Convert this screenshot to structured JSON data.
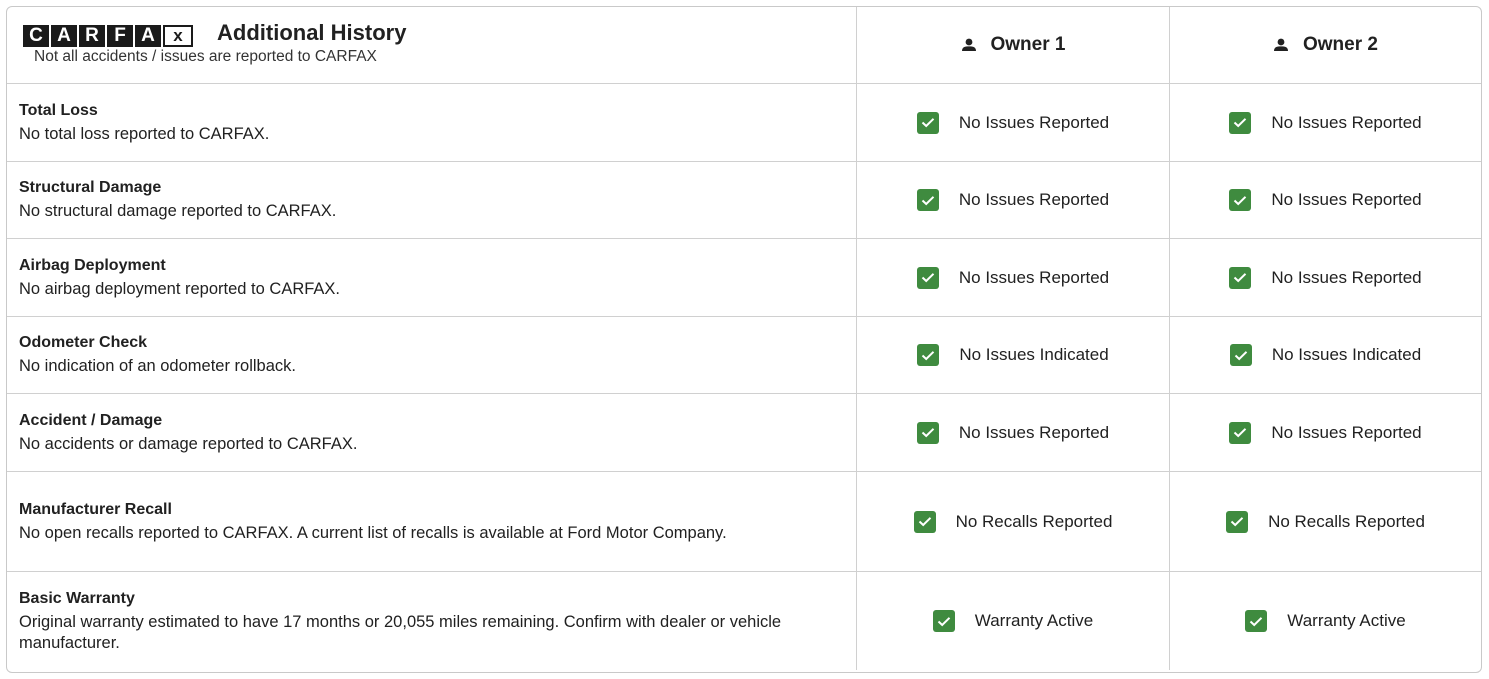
{
  "header": {
    "logo_letters": [
      "C",
      "A",
      "R",
      "F",
      "A",
      "x"
    ],
    "title": "Additional History",
    "subtitle": "Not all accidents / issues are reported to CARFAX",
    "owners": [
      "Owner 1",
      "Owner 2"
    ]
  },
  "rows": [
    {
      "title": "Total Loss",
      "desc": "No total loss reported to CARFAX.",
      "status": [
        "No Issues Reported",
        "No Issues Reported"
      ]
    },
    {
      "title": "Structural Damage",
      "desc": "No structural damage reported to CARFAX.",
      "status": [
        "No Issues Reported",
        "No Issues Reported"
      ]
    },
    {
      "title": "Airbag Deployment",
      "desc": "No airbag deployment reported to CARFAX.",
      "status": [
        "No Issues Reported",
        "No Issues Reported"
      ]
    },
    {
      "title": "Odometer Check",
      "desc": "No indication of an odometer rollback.",
      "status": [
        "No Issues Indicated",
        "No Issues Indicated"
      ]
    },
    {
      "title": "Accident / Damage",
      "desc": "No accidents or damage reported to CARFAX.",
      "status": [
        "No Issues Reported",
        "No Issues Reported"
      ]
    },
    {
      "title": "Manufacturer Recall",
      "desc": "No open recalls reported to CARFAX. A current list of recalls is available at Ford Motor Company.",
      "status": [
        "No Recalls Reported",
        "No Recalls Reported"
      ]
    },
    {
      "title": "Basic Warranty",
      "desc": "Original warranty estimated to have 17 months or 20,055 miles remaining. Confirm with dealer or vehicle manufacturer.",
      "status": [
        "Warranty Active",
        "Warranty Active"
      ]
    }
  ],
  "colors": {
    "check_green": "#3f8b3f",
    "border": "#d0d0d0",
    "logo_black": "#1a1a1a"
  },
  "icons": {
    "owner": "person-icon",
    "status": "check-icon"
  }
}
